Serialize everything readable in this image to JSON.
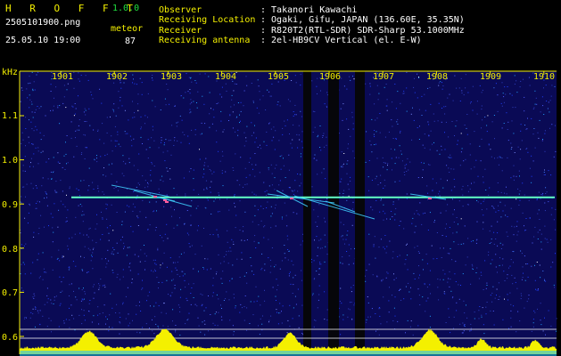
{
  "app": {
    "name": "H R O F F T",
    "version": "1.0.0"
  },
  "file": {
    "name": "2505101900.png",
    "datetime": "25.05.10 19:00"
  },
  "meteor": {
    "label": "meteor",
    "count": "87"
  },
  "info": [
    {
      "label": "Observer",
      "value": ": Takanori Kawachi"
    },
    {
      "label": "Receiving Location",
      "value": ": Ogaki, Gifu, JAPAN (136.60E, 35.35N)"
    },
    {
      "label": "Receiver",
      "value": ": R820T2(RTL-SDR) SDR-Sharp 53.1000MHz"
    },
    {
      "label": "Receiving antenna",
      "value": ": 2el-HB9CV Vertical (el. E-W)"
    }
  ],
  "colors": {
    "text": "#f4f000",
    "spectrum_bg": "#0a0a55",
    "signal": "#40ffd0",
    "histogram": "#f4f000"
  },
  "chart_data": {
    "type": "heatmap",
    "ylabel": "kHz",
    "x_ticks": [
      "1901",
      "1902",
      "1903",
      "1904",
      "1905",
      "1906",
      "1907",
      "1908",
      "1909",
      "1910"
    ],
    "y_ticks": [
      "1.1",
      "1.0",
      "0.9",
      "0.8",
      "0.7",
      "0.6"
    ],
    "ylim": [
      0.6,
      1.15
    ],
    "carrier_khz": 0.915
  }
}
